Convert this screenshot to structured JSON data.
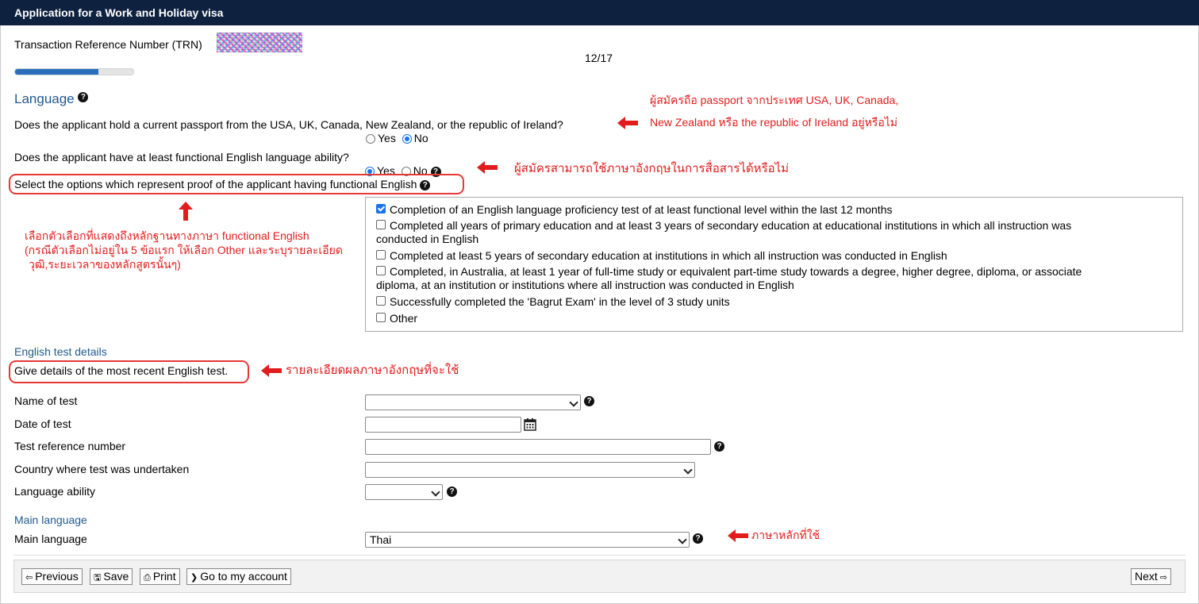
{
  "window": {
    "title": "Application for a Work and Holiday visa"
  },
  "trn": {
    "label": "Transaction Reference Number (TRN)"
  },
  "progress": {
    "text": "12/17",
    "fraction": 0.706
  },
  "language_section": {
    "title": "Language",
    "q_passport": "Does the applicant hold a current passport from the USA, UK, Canada, New Zealand, or the republic of Ireland?",
    "q_passport_yes": "Yes",
    "q_passport_no": "No",
    "q_passport_selected": "No",
    "q_english": "Does the applicant have at least functional English language ability?",
    "q_english_yes": "Yes",
    "q_english_no": "No",
    "q_english_selected": "Yes",
    "q_proof": "Select the options which represent proof of the applicant having functional English",
    "options": [
      {
        "line1": "Completion of an English language proficiency test of at least functional level within the last 12 months",
        "line2": "",
        "checked": true
      },
      {
        "line1": "Completed all years of primary education and at least 3 years of secondary education at educational institutions in which all instruction was",
        "line2": "conducted in English",
        "checked": false
      },
      {
        "line1": "Completed at least 5 years of secondary education at institutions in which all instruction was conducted in English",
        "line2": "",
        "checked": false
      },
      {
        "line1": "Completed, in Australia, at least 1 year of full-time study or equivalent part-time study towards a degree, higher degree, diploma, or associate",
        "line2": "diploma, at an institution or institutions where all instruction was conducted in English",
        "checked": false
      },
      {
        "line1": "Successfully completed the 'Bagrut Exam' in the level of 3 study units",
        "line2": "",
        "checked": false
      },
      {
        "line1": "Other",
        "line2": "",
        "checked": false
      }
    ]
  },
  "test_section": {
    "title": "English test details",
    "instruction": "Give details of the most recent English test.",
    "name_of_test": {
      "label": "Name of test",
      "value": ""
    },
    "date_of_test": {
      "label": "Date of test",
      "value": ""
    },
    "test_ref": {
      "label": "Test reference number",
      "value": ""
    },
    "country": {
      "label": "Country where test was undertaken",
      "value": ""
    },
    "ability": {
      "label": "Language ability",
      "value": ""
    }
  },
  "main_language_section": {
    "title": "Main language",
    "label": "Main language",
    "value": "Thai"
  },
  "annotations": {
    "passport_line1": "ผู้สมัครถือ passport จากประเทศ USA, UK, Canada,",
    "passport_line2": "New Zealand หรือ the republic of Ireland อยู่หรือไม่",
    "english_ability": "ผู้สมัครสามารถใช้ภาษาอังกฤษในการสื่อสารได้หรือไม่",
    "proof_line1": "เลือกตัวเลือกที่แสดงถึงหลักฐานทางภาษา functional English",
    "proof_line2": "(กรณีตัวเลือกไม่อยู่ใน 5 ข้อแรก ให้เลือก Other และระบุรายละเอียด",
    "proof_line3": "วุฒิ,ระยะเวลาของหลักสูตรนั้นๆ)",
    "test_details": "รายละเอียดผลภาษาอังกฤษที่จะใช้",
    "main_language": "ภาษาหลักที่ใช้",
    "color": "#e21c1c"
  },
  "footer": {
    "previous": "Previous",
    "save": "Save",
    "print": "Print",
    "account": "Go to my account",
    "next": "Next"
  },
  "colors": {
    "titlebar": "#0e2240",
    "section_title": "#215a8f",
    "accent": "#1a73e8"
  }
}
